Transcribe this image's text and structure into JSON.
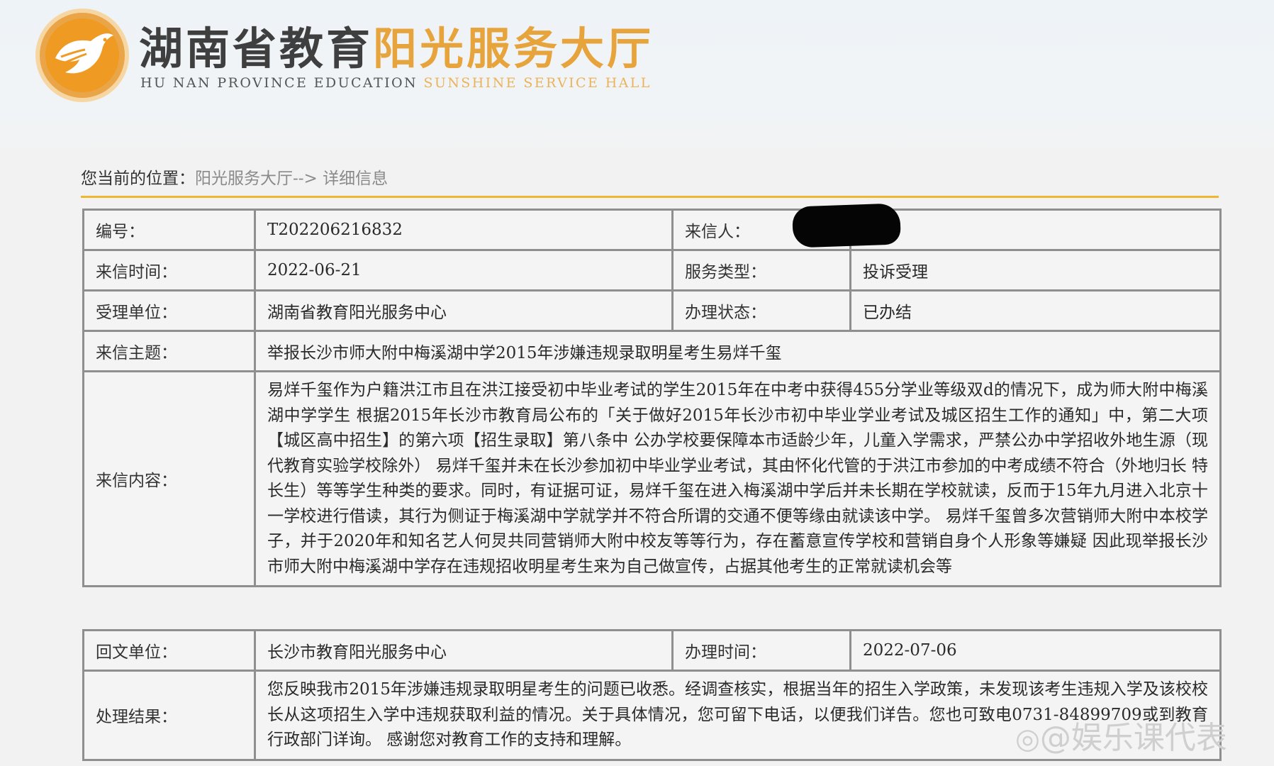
{
  "header": {
    "title_cn_a": "湖南省教育",
    "title_cn_b": "阳光服务大厅",
    "title_en_a": "HU NAN PROVINCE EDUCATION",
    "title_en_b": "SUNSHINE SERVICE HALL",
    "logo_icon": "bird-emblem-icon",
    "accent_color": "#e8a43c"
  },
  "breadcrumb": {
    "label": "您当前的位置：",
    "path": "阳光服务大厅--> 详细信息"
  },
  "letter": {
    "number_label": "编号：",
    "number": "T202206216832",
    "sender_label": "来信人：",
    "time_label": "来信时间：",
    "time": "2022-06-21",
    "service_type_label": "服务类型：",
    "service_type": "投诉受理",
    "dept_label": "受理单位：",
    "dept": "湖南省教育阳光服务中心",
    "status_label": "办理状态：",
    "status": "已办结",
    "subject_label": "来信主题：",
    "subject": "举报长沙市师大附中梅溪湖中学2015年涉嫌违规录取明星考生易烊千玺",
    "content_label": "来信内容：",
    "content": "易烊千玺作为户籍洪江市且在洪江接受初中毕业考试的学生2015年在中考中获得455分学业等级双d的情况下，成为师大附中梅溪湖中学学生 根据2015年长沙市教育局公布的「关于做好2015年长沙市初中毕业学业考试及城区招生工作的通知」中，第二大项【城区高中招生】的第六项【招生录取】第八条中 公办学校要保障本市适龄少年，儿童入学需求，严禁公办中学招收外地生源（现代教育实验学校除外） 易烊千玺并未在长沙参加初中毕业学业考试，其由怀化代管的于洪江市参加的中考成绩不符合（外地归长 特长生）等等学生种类的要求。同时，有证据可证，易烊千玺在进入梅溪湖中学后并未长期在学校就读，反而于15年九月进入北京十一学校进行借读，其行为侧证于梅溪湖中学就学并不符合所谓的交通不便等缘由就读该中学。 易烊千玺曾多次营销师大附中本校学子，并于2020年和知名艺人何炅共同营销师大附中校友等等行为，存在蓄意宣传学校和营销自身个人形象等嫌疑 因此现举报长沙市师大附中梅溪湖中学存在违规招收明星考生来为自己做宣传，占据其他考生的正常就读机会等"
  },
  "reply": {
    "unit_label": "回文单位：",
    "unit": "长沙市教育阳光服务中心",
    "time_label": "办理时间：",
    "time": "2022-07-06",
    "result_label": "处理结果：",
    "result": "您反映我市2015年涉嫌违规录取明星考生的问题已收悉。经调查核实，根据当年的招生入学政策，未发现该考生违规入学及该校校长从这项招生入学中违规获取利益的情况。关于具体情况，您可留下电话，以便我们详告。您也可致电0731-84899709或到教育行政部门详询。 感谢您对教育工作的支持和理解。"
  },
  "watermark": {
    "icon": "weibo-icon",
    "text": "@娱乐课代表"
  }
}
